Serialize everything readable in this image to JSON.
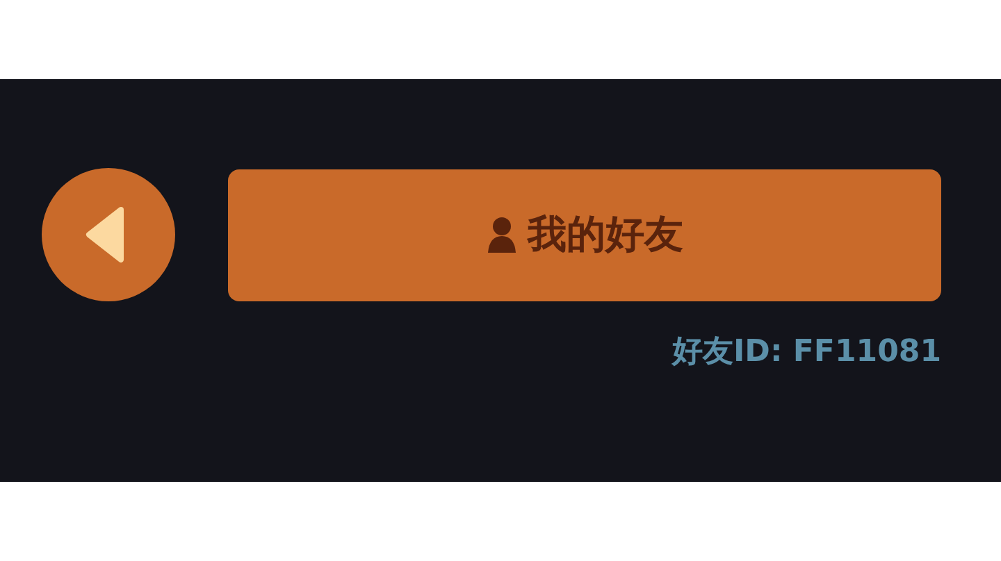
{
  "header": {
    "title_button": {
      "label": "我的好友"
    },
    "friend_id": "好友ID: FF11081"
  }
}
